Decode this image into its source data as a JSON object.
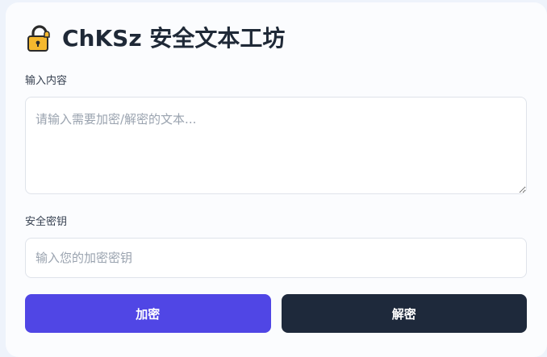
{
  "app": {
    "title": "ChKSz 安全文本工坊",
    "icon": "lock-icon"
  },
  "content": {
    "label": "输入内容",
    "placeholder": "请输入需要加密/解密的文本...",
    "value": ""
  },
  "key": {
    "label": "安全密钥",
    "placeholder": "输入您的加密密钥",
    "value": ""
  },
  "actions": {
    "encrypt_label": "加密",
    "decrypt_label": "解密"
  },
  "colors": {
    "page_background": "#eef3fb",
    "card_background": "#fbfcfe",
    "title_text": "#1f2937",
    "encrypt_button": "#5046e5",
    "decrypt_button": "#1e293b",
    "lock_body": "#f5b82e"
  }
}
